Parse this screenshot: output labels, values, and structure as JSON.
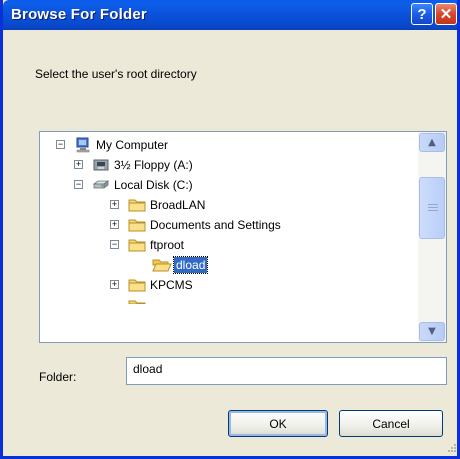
{
  "window": {
    "title": "Browse For Folder",
    "help_label": "?",
    "close_label": "✕"
  },
  "dialog": {
    "prompt": "Select the user's root directory"
  },
  "tree": {
    "nodes": [
      {
        "label": "My Computer",
        "icon": "computer-icon",
        "expander": "−"
      },
      {
        "label": "3½ Floppy (A:)",
        "icon": "floppy-drive-icon",
        "expander": "+"
      },
      {
        "label": "Local Disk (C:)",
        "icon": "hard-disk-icon",
        "expander": "−"
      },
      {
        "label": "BroadLAN",
        "icon": "folder-icon",
        "expander": "+"
      },
      {
        "label": "Documents and Settings",
        "icon": "folder-icon",
        "expander": "+"
      },
      {
        "label": "ftproot",
        "icon": "folder-icon",
        "expander": "−"
      },
      {
        "label": "dload",
        "icon": "open-folder-icon",
        "expander": ""
      },
      {
        "label": "KPCMS",
        "icon": "folder-icon",
        "expander": "+"
      }
    ],
    "selected": "dload"
  },
  "folder": {
    "label": "Folder:",
    "value": "dload"
  },
  "buttons": {
    "ok": "OK",
    "cancel": "Cancel"
  },
  "colors": {
    "titlebar": "#0b51db",
    "selection": "#316ac5",
    "dialog_bg": "#ece9d8"
  }
}
